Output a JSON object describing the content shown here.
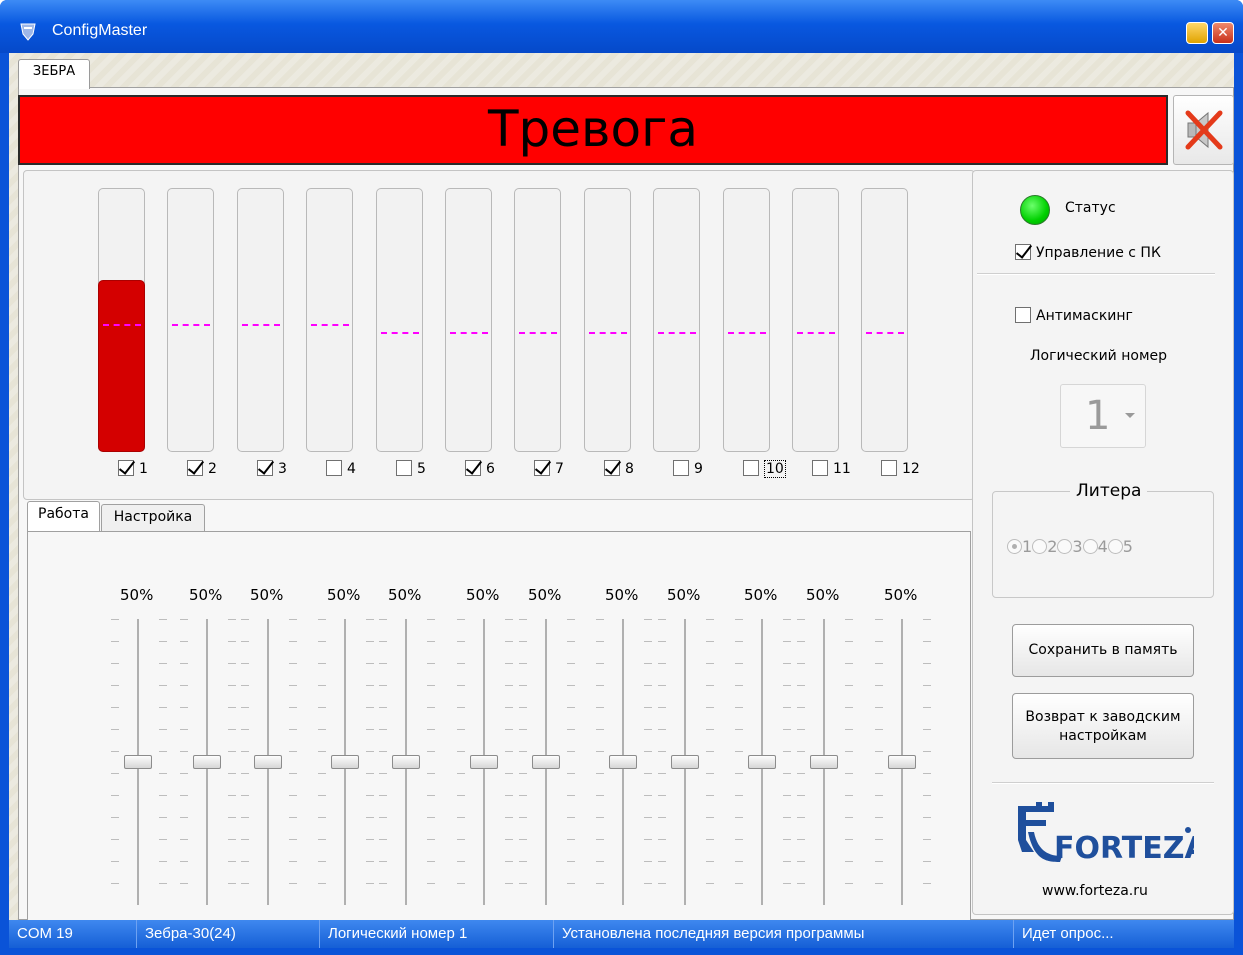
{
  "window": {
    "title": "ConfigMaster",
    "min_label": "",
    "close_label": "✕"
  },
  "top_tab": {
    "label": "ЗЕБРА"
  },
  "alarm": {
    "text": "Тревога",
    "color": "#ff0000"
  },
  "channels": [
    {
      "num": "1",
      "checked": true,
      "level": 0.65,
      "threshold": 0.49
    },
    {
      "num": "2",
      "checked": true,
      "level": 0.0,
      "threshold": 0.49
    },
    {
      "num": "3",
      "checked": true,
      "level": 0.0,
      "threshold": 0.49
    },
    {
      "num": "4",
      "checked": false,
      "level": 0.0,
      "threshold": 0.49
    },
    {
      "num": "5",
      "checked": false,
      "level": 0.0,
      "threshold": 0.46
    },
    {
      "num": "6",
      "checked": true,
      "level": 0.0,
      "threshold": 0.46
    },
    {
      "num": "7",
      "checked": true,
      "level": 0.0,
      "threshold": 0.46
    },
    {
      "num": "8",
      "checked": true,
      "level": 0.0,
      "threshold": 0.46
    },
    {
      "num": "9",
      "checked": false,
      "level": 0.0,
      "threshold": 0.46
    },
    {
      "num": "10",
      "checked": false,
      "level": 0.0,
      "threshold": 0.46
    },
    {
      "num": "11",
      "checked": false,
      "level": 0.0,
      "threshold": 0.46
    },
    {
      "num": "12",
      "checked": false,
      "level": 0.0,
      "threshold": 0.46
    }
  ],
  "sub_tabs": [
    {
      "label": "Работа"
    },
    {
      "label": "Настройка"
    }
  ],
  "sliders": [
    {
      "label": "50%",
      "value": 0.5
    },
    {
      "label": "50%",
      "value": 0.5
    },
    {
      "label": "50%",
      "value": 0.5
    },
    {
      "label": "50%",
      "value": 0.5
    },
    {
      "label": "50%",
      "value": 0.5
    },
    {
      "label": "50%",
      "value": 0.5
    },
    {
      "label": "50%",
      "value": 0.5
    },
    {
      "label": "50%",
      "value": 0.5
    },
    {
      "label": "50%",
      "value": 0.5
    },
    {
      "label": "50%",
      "value": 0.5
    },
    {
      "label": "50%",
      "value": 0.5
    },
    {
      "label": "50%",
      "value": 0.5
    }
  ],
  "right": {
    "status_label": "Статус",
    "status_color": "#00d000",
    "pc_control_label": "Управление с ПК",
    "pc_control_checked": true,
    "antimasking_label": "Антимаскинг",
    "antimasking_checked": false,
    "logical_number_label": "Логический номер",
    "logical_number_value": "1",
    "litera_label": "Литера",
    "litera_options": [
      "1",
      "2",
      "3",
      "4",
      "5"
    ],
    "litera_selected": "1",
    "save_button": "Сохранить в память",
    "reset_button_line1": "Возврат к заводским",
    "reset_button_line2": "настройкам",
    "logo_name": "FORTEZA",
    "website": "www.forteza.ru"
  },
  "statusbar": {
    "port": "COM 19",
    "device": "Зебра-30(24)",
    "logical": "Логический номер 1",
    "version": "Установлена последняя версия программы",
    "polling": "Идет опрос..."
  }
}
